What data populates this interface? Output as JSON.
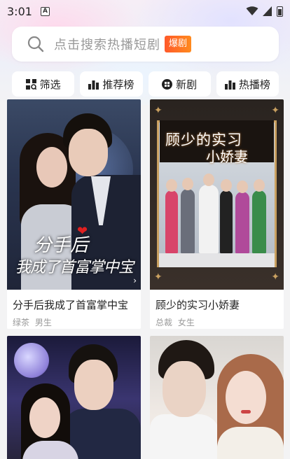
{
  "status_bar": {
    "time": "3:01",
    "notif_letter": "A"
  },
  "search": {
    "placeholder": "点击搜索热播短剧",
    "badge": "爆剧"
  },
  "filters": [
    {
      "label": "筛选",
      "icon": "filter-grid-icon"
    },
    {
      "label": "推荐榜",
      "icon": "ranking-bars-icon"
    },
    {
      "label": "新剧",
      "icon": "new-drama-icon"
    },
    {
      "label": "热播榜",
      "icon": "ranking-bars-icon"
    }
  ],
  "dramas": [
    {
      "title": "分手后我成了首富掌中宝",
      "tags": [
        "绿茶",
        "男生"
      ],
      "poster": {
        "caption_top": "分手后",
        "caption_bottom": "我成了首富掌中宝"
      }
    },
    {
      "title": "顾少的实习小娇妻",
      "tags": [
        "总裁",
        "女生"
      ],
      "poster": {
        "caption_top": "顾少的实习",
        "caption_bottom": "小娇妻"
      }
    },
    {
      "title": "",
      "tags": []
    },
    {
      "title": "",
      "tags": []
    }
  ],
  "colors": {
    "accent": "#ff6a24",
    "background": "#f3f3f4",
    "text": "#222222",
    "tag": "#999999"
  }
}
